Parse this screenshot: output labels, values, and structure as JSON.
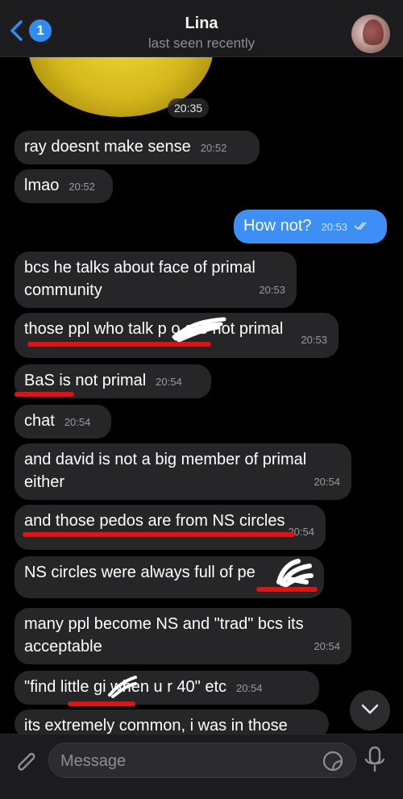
{
  "header": {
    "back_badge": "1",
    "title": "Lina",
    "status": "last seen recently"
  },
  "sticker": {
    "time": "20:35"
  },
  "messages": [
    {
      "text": "ray doesnt make sense",
      "time": "20:52"
    },
    {
      "text": "lmao",
      "time": "20:52"
    },
    {
      "text": "How not?",
      "time": "20:53",
      "outgoing": true
    },
    {
      "text": "bcs he talks about face of primal community",
      "time": "20:53"
    },
    {
      "text": "those ppl who talk p   o are not primal",
      "time": "20:53"
    },
    {
      "text": "BaS is not primal",
      "time": "20:54"
    },
    {
      "text": "chat",
      "time": "20:54"
    },
    {
      "text": "and david is not a big member of primal either",
      "time": "20:54"
    },
    {
      "text": "and those pedos are from NS circles",
      "time": "20:54"
    },
    {
      "text": "NS circles were always full of pe",
      "time": ""
    },
    {
      "text": "many ppl become NS and \"trad\" bcs its acceptable",
      "time": "20:54"
    },
    {
      "text": "\"find little gi   when u r 40\" etc",
      "time": "20:54"
    },
    {
      "text": "its extremely common, i was in those",
      "time": ""
    }
  ],
  "bubble_lines": {
    "m3_line1": "bcs he talks about face of primal",
    "m3_line2": "community",
    "m7_line1": "and david is not a big member of primal",
    "m7_line2": "either",
    "m10_line1": "many ppl become NS and \"trad\" bcs its",
    "m10_line2": "acceptable",
    "m8_time_visible": "20:54"
  },
  "input": {
    "placeholder": "Message"
  },
  "colors": {
    "outgoing": "#3d8ef5",
    "incoming": "#262628",
    "annotation": "#e11212"
  }
}
